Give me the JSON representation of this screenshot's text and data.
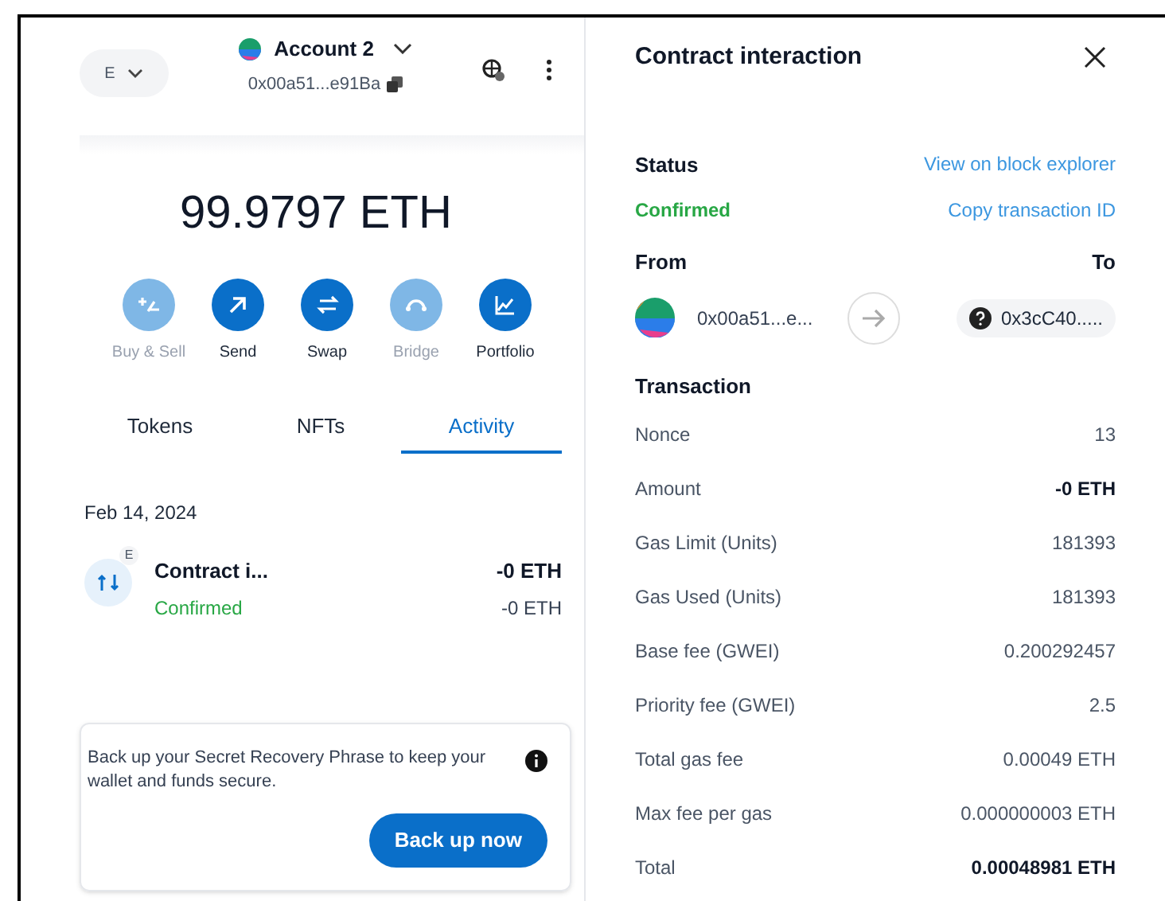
{
  "wallet": {
    "network": "E",
    "account": "Account 2",
    "address": "0x00a51...e91Ba",
    "balance": "99.9797 ETH",
    "actions": [
      {
        "kind": "buy-sell",
        "label": "Buy & Sell",
        "disabled": true
      },
      {
        "kind": "send",
        "label": "Send",
        "disabled": false
      },
      {
        "kind": "swap",
        "label": "Swap",
        "disabled": false
      },
      {
        "kind": "bridge",
        "label": "Bridge",
        "disabled": true
      },
      {
        "kind": "portfolio",
        "label": "Portfolio",
        "disabled": false
      }
    ],
    "tabs": [
      {
        "label": "Tokens",
        "selected": false
      },
      {
        "label": "NFTs",
        "selected": false
      },
      {
        "label": "Activity",
        "selected": true
      }
    ],
    "activity": {
      "date": "Feb 14, 2024",
      "items": [
        {
          "badge": "E",
          "title": "Contract i...",
          "status": "Confirmed",
          "amount": "-0 ETH",
          "fiat": "-0 ETH"
        }
      ]
    },
    "backup": {
      "message": "Back up your Secret Recovery Phrase to keep your wallet and funds secure.",
      "button": "Back up now"
    }
  },
  "details": {
    "title": "Contract interaction",
    "status_label": "Status",
    "status": "Confirmed",
    "explorer_link": "View on block explorer",
    "copy_link": "Copy transaction ID",
    "from_label": "From",
    "to_label": "To",
    "from": "0x00a51...e...",
    "to": "0x3cC40.....",
    "transaction_label": "Transaction",
    "rows": [
      {
        "label": "Nonce",
        "value": "13",
        "bold": false
      },
      {
        "label": "Amount",
        "value": "-0 ETH",
        "bold": true
      },
      {
        "label": "Gas Limit (Units)",
        "value": "181393",
        "bold": false
      },
      {
        "label": "Gas Used (Units)",
        "value": "181393",
        "bold": false
      },
      {
        "label": "Base fee (GWEI)",
        "value": "0.200292457",
        "bold": false
      },
      {
        "label": "Priority fee (GWEI)",
        "value": "2.5",
        "bold": false
      },
      {
        "label": "Total gas fee",
        "value": "0.00049 ETH",
        "bold": false
      },
      {
        "label": "Max fee per gas",
        "value": "0.000000003 ETH",
        "bold": false
      },
      {
        "label": "Total",
        "value": "0.00048981 ETH",
        "bold": true
      }
    ]
  }
}
